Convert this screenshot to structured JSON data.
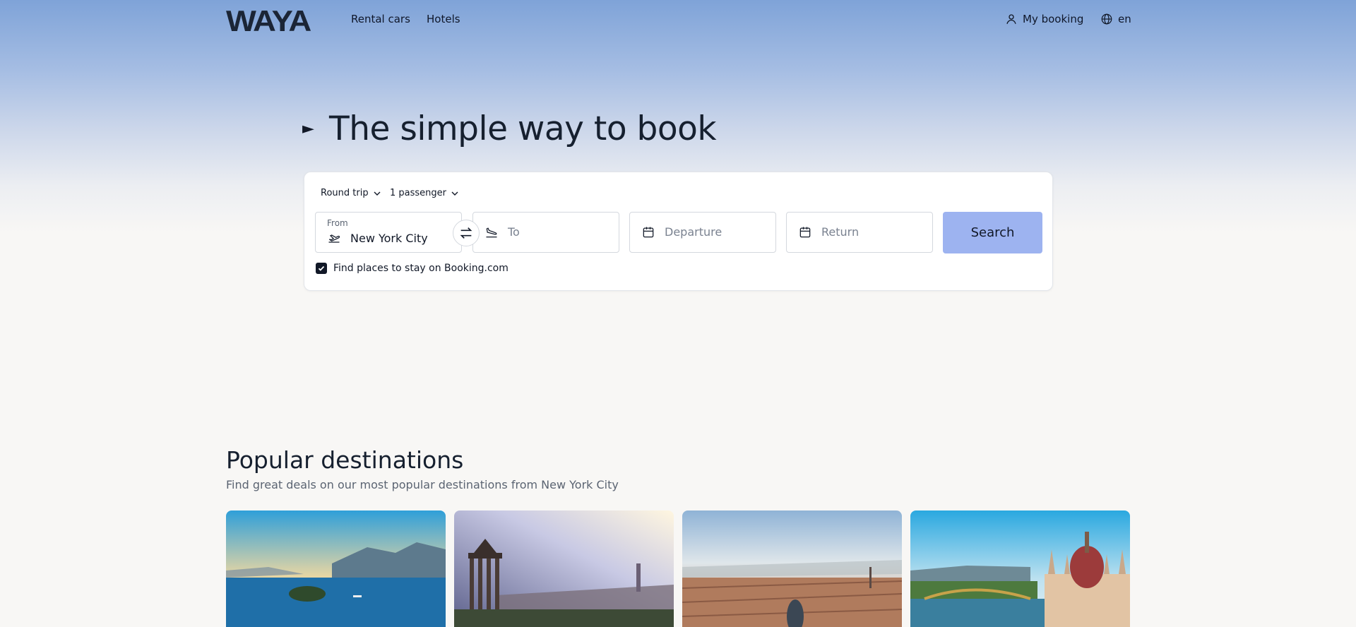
{
  "brand": {
    "logo": "WAYA"
  },
  "nav": {
    "links": [
      "Rental cars",
      "Hotels"
    ],
    "my_booking": "My booking",
    "language": "en"
  },
  "hero": {
    "headline": "The simple way to book"
  },
  "search": {
    "trip_type": "Round trip",
    "passengers": "1 passenger",
    "from_label": "From",
    "from_value": "New York City",
    "to_placeholder": "To",
    "departure_placeholder": "Departure",
    "return_placeholder": "Return",
    "search_label": "Search",
    "stay_checkbox_label": "Find places to stay on Booking.com",
    "stay_checked": true
  },
  "popular": {
    "title": "Popular destinations",
    "subtitle": "Find great deals on our most popular destinations from New York City"
  },
  "colors": {
    "search_button": "#9db3f0",
    "text_dark": "#16202f",
    "hero_top": "#7fa3d8"
  }
}
